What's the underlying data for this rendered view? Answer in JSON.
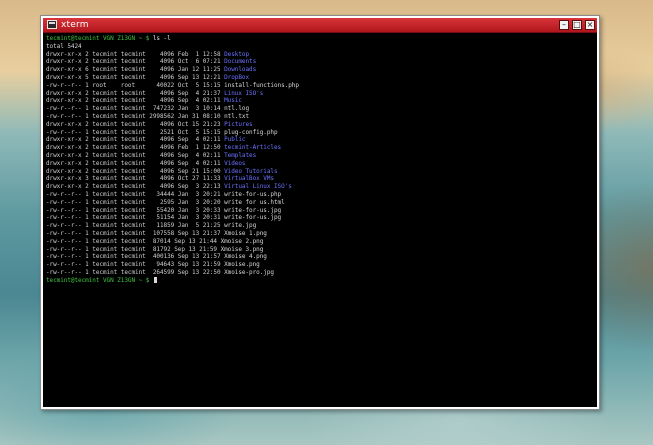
{
  "window": {
    "title": "xterm",
    "buttons": {
      "minimize": "–",
      "maximize": "□",
      "close": "×"
    }
  },
  "terminal": {
    "prompt": "tecmint@tecmint VGN Z13GN ~ $",
    "command": " ls -l",
    "total": "total 5424",
    "entries": [
      {
        "meta": "drwxr-xr-x 2 tecmint tecmint    4096 Feb  1 12:58 ",
        "name": "Desktop",
        "type": "dir"
      },
      {
        "meta": "drwxr-xr-x 2 tecmint tecmint    4096 Oct  6 07:21 ",
        "name": "Documents",
        "type": "dir"
      },
      {
        "meta": "drwxr-xr-x 6 tecmint tecmint    4096 Jan 12 11:25 ",
        "name": "Downloads",
        "type": "dir"
      },
      {
        "meta": "drwxr-xr-x 5 tecmint tecmint    4096 Sep 13 12:21 ",
        "name": "DropBox",
        "type": "dir"
      },
      {
        "meta": "-rw-r--r-- 1 root    root      40022 Oct  5 15:15 ",
        "name": "install-functions.php",
        "type": "file"
      },
      {
        "meta": "drwxr-xr-x 2 tecmint tecmint    4096 Sep  4 21:37 ",
        "name": "Linux ISO's",
        "type": "dir"
      },
      {
        "meta": "drwxr-xr-x 2 tecmint tecmint    4096 Sep  4 02:11 ",
        "name": "Music",
        "type": "dir"
      },
      {
        "meta": "-rw-r--r-- 1 tecmint tecmint  747232 Jan  3 10:14 ",
        "name": "ntl.log",
        "type": "file"
      },
      {
        "meta": "-rw-r--r-- 1 tecmint tecmint 2998562 Jan 31 08:10 ",
        "name": "ntl.txt",
        "type": "file"
      },
      {
        "meta": "drwxr-xr-x 2 tecmint tecmint    4096 Oct 15 21:23 ",
        "name": "Pictures",
        "type": "dir"
      },
      {
        "meta": "-rw-r--r-- 1 tecmint tecmint    2521 Oct  5 15:15 ",
        "name": "plug-config.php",
        "type": "file"
      },
      {
        "meta": "drwxr-xr-x 2 tecmint tecmint    4096 Sep  4 02:11 ",
        "name": "Public",
        "type": "dir"
      },
      {
        "meta": "drwxr-xr-x 2 tecmint tecmint    4096 Feb  1 12:50 ",
        "name": "tecmint-Articles",
        "type": "dir"
      },
      {
        "meta": "drwxr-xr-x 2 tecmint tecmint    4096 Sep  4 02:11 ",
        "name": "Templates",
        "type": "dir"
      },
      {
        "meta": "drwxr-xr-x 2 tecmint tecmint    4096 Sep  4 02:11 ",
        "name": "Videos",
        "type": "dir"
      },
      {
        "meta": "drwxr-xr-x 2 tecmint tecmint    4096 Sep 21 15:00 ",
        "name": "Video Tutorials",
        "type": "dir"
      },
      {
        "meta": "drwxr-xr-x 3 tecmint tecmint    4096 Oct 27 11:33 ",
        "name": "VirtualBox VMs",
        "type": "dir"
      },
      {
        "meta": "drwxr-xr-x 2 tecmint tecmint    4096 Sep  3 22:13 ",
        "name": "Virtual Linux ISO's",
        "type": "dir"
      },
      {
        "meta": "-rw-r--r-- 1 tecmint tecmint   34444 Jan  3 20:21 ",
        "name": "write-for-us.php",
        "type": "file"
      },
      {
        "meta": "-rw-r--r-- 1 tecmint tecmint    2595 Jan  3 20:20 ",
        "name": "write for us.html",
        "type": "file"
      },
      {
        "meta": "-rw-r--r-- 1 tecmint tecmint   55420 Jan  3 20:33 ",
        "name": "write-for-us.jpg",
        "type": "file"
      },
      {
        "meta": "-rw-r--r-- 1 tecmint tecmint   51154 Jan  3 20:31 ",
        "name": "write-for-us.jpg",
        "type": "file"
      },
      {
        "meta": "-rw-r--r-- 1 tecmint tecmint   11859 Jan  5 21:25 ",
        "name": "write.jpg",
        "type": "file"
      },
      {
        "meta": "-rw-r--r-- 1 tecmint tecmint  107558 Sep 13 21:37 ",
        "name": "Xmoise 1.png",
        "type": "file"
      },
      {
        "meta": "-rw-r--r-- 1 tecmint tecmint  87014 Sep 13 21:44 ",
        "name": "Xmoise 2.png",
        "type": "file"
      },
      {
        "meta": "-rw-r--r-- 1 tecmint tecmint  81792 Sep 13 21:59 ",
        "name": "Xmoise 3.png",
        "type": "file"
      },
      {
        "meta": "-rw-r--r-- 1 tecmint tecmint  400136 Sep 13 21:57 ",
        "name": "Xmoise 4.png",
        "type": "file"
      },
      {
        "meta": "-rw-r--r-- 1 tecmint tecmint   94643 Sep 13 21:59 ",
        "name": "Xmoise.png",
        "type": "file"
      },
      {
        "meta": "-rw-r--r-- 1 tecmint tecmint  264599 Sep 13 22:50 ",
        "name": "Xmoise-pro.jpg",
        "type": "file"
      }
    ],
    "final_prompt": "tecmint@tecmint VGN Z13GN ~ $"
  },
  "colors": {
    "prompt": "#3ec43e",
    "directory": "#6b73ff",
    "text": "#d8d8d8",
    "titlebar": "#c0202a"
  }
}
